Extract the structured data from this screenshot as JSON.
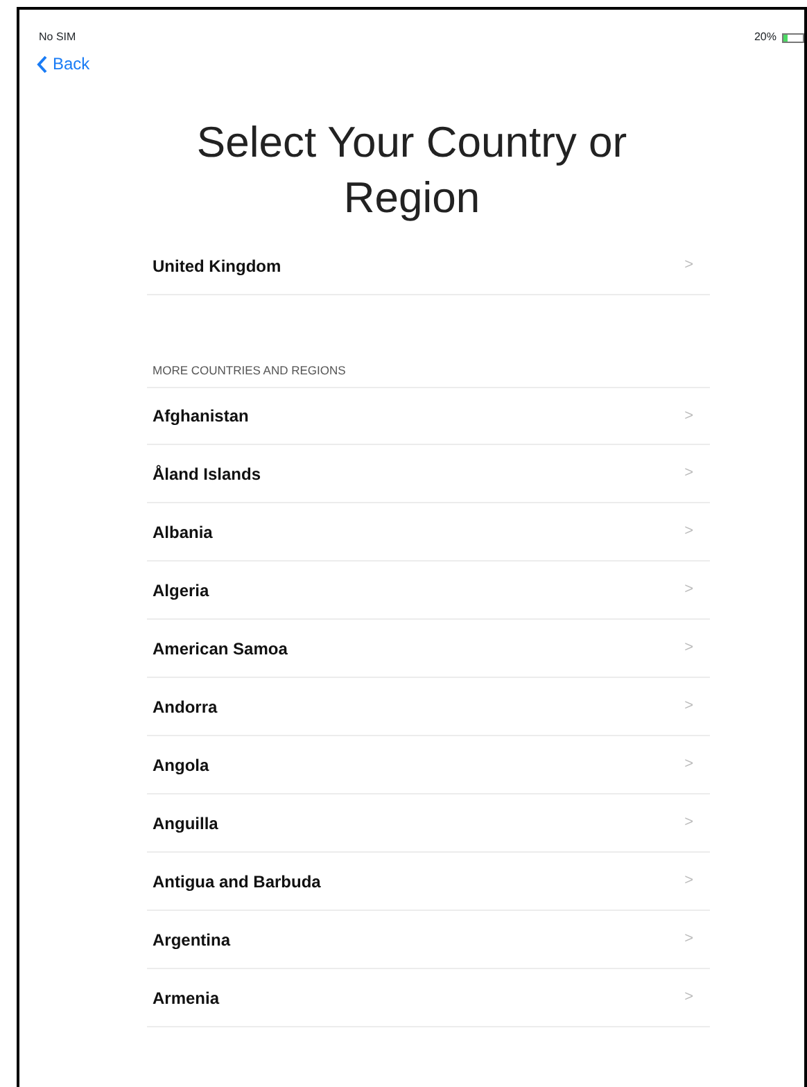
{
  "status_bar": {
    "carrier": "No SIM",
    "battery_text": "20%",
    "battery": {
      "level": 0.2
    }
  },
  "nav": {
    "back": "Back"
  },
  "title": "Select Your Country or Region",
  "suggested": [
    {
      "name": "United Kingdom",
      "chevron": ">"
    }
  ],
  "section_header": "MORE COUNTRIES AND REGIONS",
  "countries": [
    {
      "name": "Afghanistan",
      "chevron": ">"
    },
    {
      "name": "Åland Islands",
      "chevron": ">"
    },
    {
      "name": "Albania",
      "chevron": ">"
    },
    {
      "name": "Algeria",
      "chevron": ">"
    },
    {
      "name": "American Samoa",
      "chevron": ">"
    },
    {
      "name": "Andorra",
      "chevron": ">"
    },
    {
      "name": "Angola",
      "chevron": ">"
    },
    {
      "name": "Anguilla",
      "chevron": ">"
    },
    {
      "name": "Antigua and Barbuda",
      "chevron": ">"
    },
    {
      "name": "Argentina",
      "chevron": ">"
    },
    {
      "name": "Armenia",
      "chevron": ">"
    }
  ]
}
